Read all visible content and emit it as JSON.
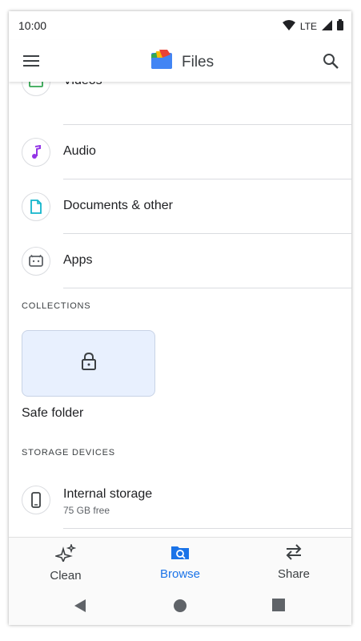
{
  "status_bar": {
    "time": "10:00",
    "network": "LTE"
  },
  "app_bar": {
    "title": "Files"
  },
  "categories": [
    {
      "label": "Videos",
      "icon": "videos-icon"
    },
    {
      "label": "Audio",
      "icon": "audio-icon"
    },
    {
      "label": "Documents & other",
      "icon": "document-icon"
    },
    {
      "label": "Apps",
      "icon": "apps-icon"
    }
  ],
  "collections": {
    "header": "COLLECTIONS",
    "safe_folder_label": "Safe folder"
  },
  "storage": {
    "header": "STORAGE DEVICES",
    "devices": [
      {
        "label": "Internal storage",
        "sub": "75 GB free"
      }
    ]
  },
  "bottom_nav": [
    {
      "label": "Clean",
      "active": false
    },
    {
      "label": "Browse",
      "active": true
    },
    {
      "label": "Share",
      "active": false
    }
  ],
  "colors": {
    "accent": "#1a73e8",
    "videos": "#34a853",
    "audio": "#9334e6",
    "documents": "#12b5cb",
    "apps": "#5f6368"
  }
}
